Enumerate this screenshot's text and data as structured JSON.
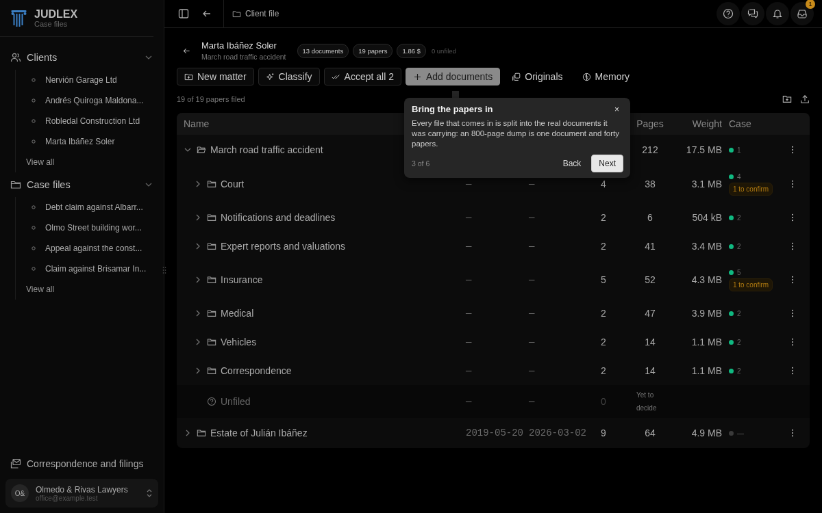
{
  "brand": {
    "name": "JUDLEX",
    "subtitle": "Case files"
  },
  "sidebar": {
    "sections": [
      {
        "title": "Clients",
        "expanded": true,
        "items": [
          "Nervión Garage Ltd",
          "Andrés Quiroga Maldona...",
          "Robledal Construction Ltd",
          "Marta Ibáñez Soler"
        ],
        "more": "View all"
      },
      {
        "title": "Case files",
        "expanded": true,
        "items": [
          "Debt claim against Albarr...",
          "Olmo Street building wor...",
          "Appeal against the const...",
          "Claim against Brisamar In..."
        ],
        "more": "View all"
      }
    ],
    "footer_link": "Correspondence and filings",
    "account": {
      "initials": "O&",
      "name": "Olmedo & Rivas Lawyers",
      "email": "office@example.test"
    }
  },
  "topbar": {
    "breadcrumb": "Client file",
    "inbox_badge": "1"
  },
  "header": {
    "client": "Marta Ibáñez Soler",
    "matter": "March road traffic accident",
    "chips": [
      {
        "text": "13 documents",
        "kind": "chip"
      },
      {
        "text": "19 papers",
        "kind": "chip"
      },
      {
        "text": "1.86 $",
        "kind": "chip"
      },
      {
        "text": "0 unfiled",
        "kind": "plain"
      }
    ]
  },
  "toolbar": [
    {
      "label": "New matter",
      "kind": "outline"
    },
    {
      "label": "Classify",
      "kind": "outline"
    },
    {
      "label": "Accept all 2",
      "kind": "outline"
    },
    {
      "label": "Add documents",
      "kind": "highlight"
    },
    {
      "label": "Originals",
      "kind": "ghost"
    },
    {
      "label": "Memory",
      "kind": "ghost"
    }
  ],
  "filed_summary": "19 of 19 papers filed",
  "table": {
    "columns": [
      "Name",
      "Pages",
      "Weight",
      "Case"
    ],
    "rows": [
      {
        "name": "March road traffic accident",
        "kind": "folder",
        "expanded": true,
        "pages": "212",
        "weight": "17.5 MB",
        "case": {
          "color": "#10b981",
          "count": "1"
        },
        "children": [
          {
            "name": "Court",
            "kind": "folder",
            "expanded": false,
            "start": "—",
            "end": "—",
            "docs": "4",
            "pages": "38",
            "weight": "3.1 MB",
            "case": {
              "color": "#10b981",
              "count": "4",
              "badge": "1 to confirm"
            }
          },
          {
            "name": "Notifications and deadlines",
            "kind": "folder",
            "expanded": false,
            "start": "—",
            "end": "—",
            "docs": "2",
            "pages": "6",
            "weight": "504 kB",
            "case": {
              "color": "#10b981",
              "count": "2"
            }
          },
          {
            "name": "Expert reports and valuations",
            "kind": "folder",
            "expanded": false,
            "start": "—",
            "end": "—",
            "docs": "2",
            "pages": "41",
            "weight": "3.4 MB",
            "case": {
              "color": "#10b981",
              "count": "2"
            }
          },
          {
            "name": "Insurance",
            "kind": "folder",
            "expanded": false,
            "start": "—",
            "end": "—",
            "docs": "5",
            "pages": "52",
            "weight": "4.3 MB",
            "case": {
              "color": "#10b981",
              "count": "5",
              "badge": "1 to confirm"
            }
          },
          {
            "name": "Medical",
            "kind": "folder",
            "expanded": false,
            "start": "—",
            "end": "—",
            "docs": "2",
            "pages": "47",
            "weight": "3.9 MB",
            "case": {
              "color": "#10b981",
              "count": "2"
            }
          },
          {
            "name": "Vehicles",
            "kind": "folder",
            "expanded": false,
            "start": "—",
            "end": "—",
            "docs": "2",
            "pages": "14",
            "weight": "1.1 MB",
            "case": {
              "color": "#10b981",
              "count": "2"
            }
          },
          {
            "name": "Correspondence",
            "kind": "folder",
            "expanded": false,
            "start": "—",
            "end": "—",
            "docs": "2",
            "pages": "14",
            "weight": "1.1 MB",
            "case": {
              "color": "#10b981",
              "count": "2"
            }
          },
          {
            "name": "Unfiled",
            "kind": "unfiled",
            "start": "—",
            "end": "—",
            "docs": "0",
            "pages": "Yet to decide"
          }
        ]
      },
      {
        "name": "Estate of Julián Ibáñez",
        "kind": "folder",
        "expanded": false,
        "start": "2019-05-20",
        "end": "2026-03-02",
        "docs": "9",
        "pages": "64",
        "weight": "4.9 MB",
        "case": {
          "color": "#3a3a3a",
          "count": "—"
        }
      }
    ]
  },
  "tour": {
    "title": "Bring the papers in",
    "body": "Every file that comes in is split into the real documents it was carrying: an 800-page dump is one document and forty papers.",
    "step": "3 of 6",
    "back": "Back",
    "next": "Next",
    "close": "×"
  }
}
